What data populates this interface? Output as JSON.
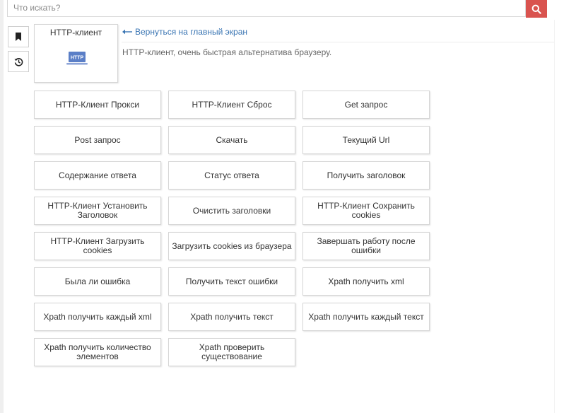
{
  "search": {
    "placeholder": "Что искать?"
  },
  "sidebar": {
    "buttons": [
      {
        "icon": "bookmark-icon"
      },
      {
        "icon": "history-icon"
      }
    ]
  },
  "module": {
    "title": "HTTP-клиент",
    "icon_text": "HTTP",
    "back_label": "Вернуться на главный экран",
    "description": "HTTP-клиент, очень быстрая альтернатива браузеру."
  },
  "actions": [
    "HTTP-Клиент Прокси",
    "HTTP-Клиент Сброс",
    "Get запрос",
    "Post запрос",
    "Скачать",
    "Текущий Url",
    "Содержание ответа",
    "Статус ответа",
    "Получить заголовок",
    "HTTP-Клиент Установить Заголовок",
    "Очистить заголовки",
    "HTTP-Клиент Сохранить cookies",
    "HTTP-Клиент Загрузить cookies",
    "Загрузить cookies из браузера",
    "Завершать работу после ошибки",
    "Была ли ошибка",
    "Получить текст ошибки",
    "Xpath получить xml",
    "Xpath получить каждый xml",
    "Xpath получить текст",
    "Xpath получить каждый текст",
    "Xpath получить количество элементов",
    "Xpath проверить существование"
  ],
  "colors": {
    "accent": "#d9534f",
    "link": "#3a75b3",
    "icon_blue": "#5b7fc7"
  }
}
